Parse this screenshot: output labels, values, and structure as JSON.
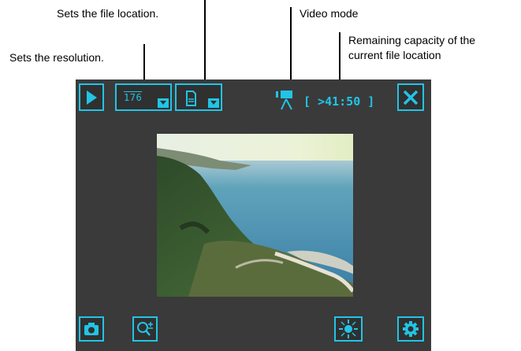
{
  "annotations": {
    "file_location": "Sets the file location.",
    "video_mode": "Video mode",
    "capacity": "Remaining capacity of the\ncurrent file location",
    "resolution": "Sets the resolution."
  },
  "toolbar": {
    "resolution_value": "176",
    "capacity_text": "[ >41:50 ]"
  },
  "icons": {
    "play": "play-icon",
    "file_location": "memory-card-icon",
    "video_mode": "video-camera-icon",
    "close": "close-icon",
    "camera": "camera-icon",
    "zoom": "zoom-in-icon",
    "brightness": "brightness-icon",
    "settings": "gear-icon"
  },
  "colors": {
    "accent": "#22c4e6",
    "screen_background": "#3a3a3a"
  }
}
